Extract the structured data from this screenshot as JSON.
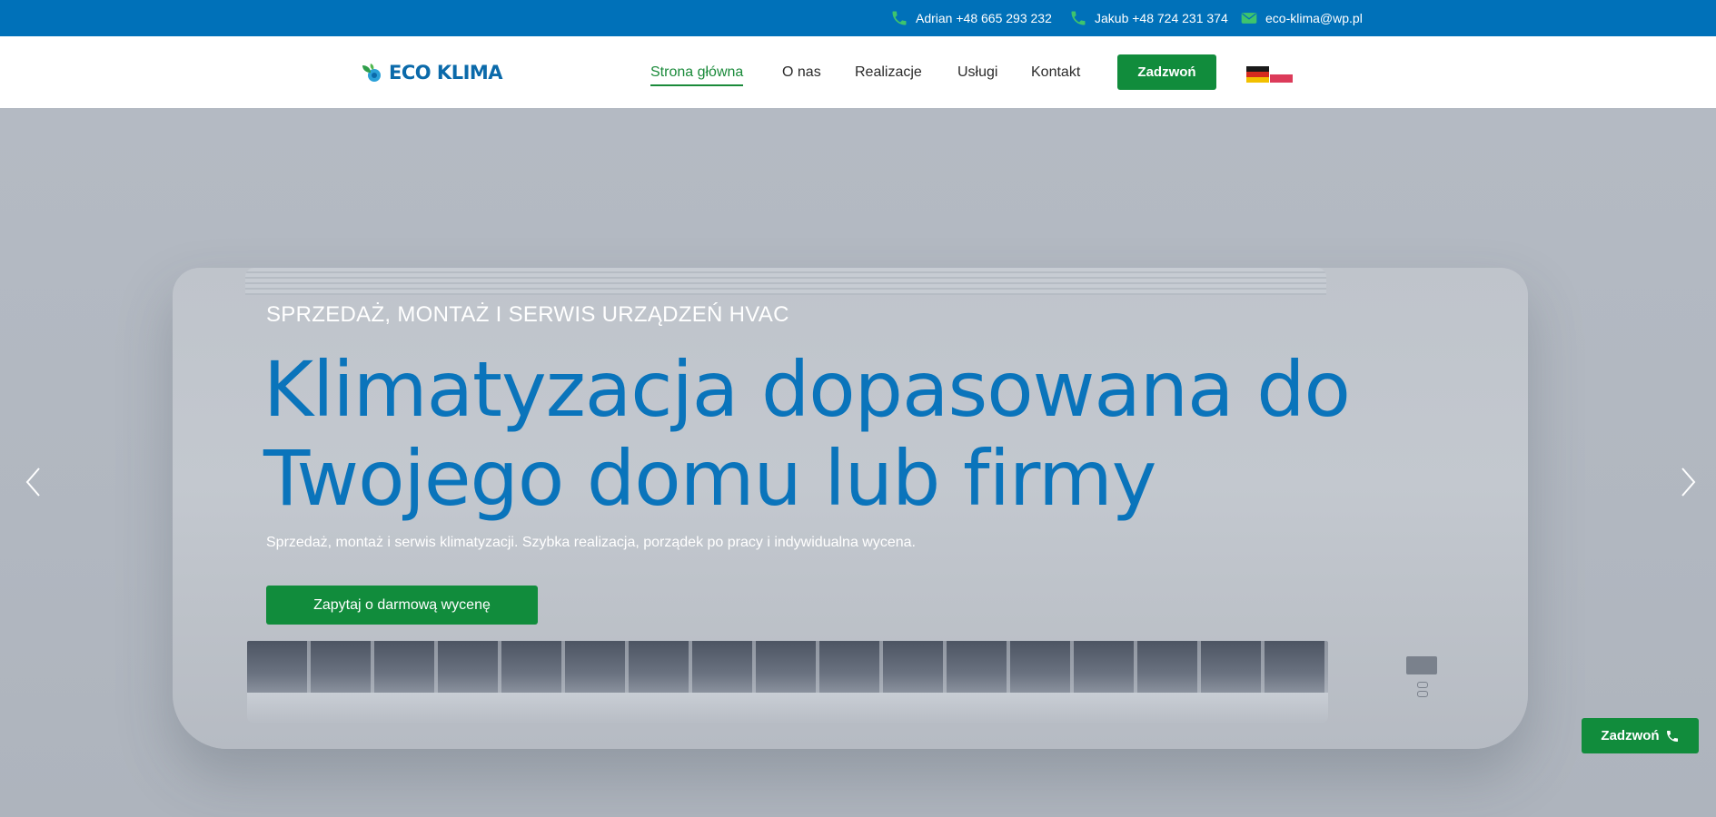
{
  "topbar": {
    "contacts": [
      {
        "icon": "phone-icon",
        "label": "Adrian +48 665 293 232"
      },
      {
        "icon": "phone-icon",
        "label": "Jakub +48 724 231 374"
      },
      {
        "icon": "envelope-icon",
        "label": "eco-klima@wp.pl"
      }
    ]
  },
  "header": {
    "logo_text": "ECO KLIMA",
    "nav": [
      {
        "label": "Strona główna",
        "active": true
      },
      {
        "label": "O nas"
      },
      {
        "label": "Realizacje"
      },
      {
        "label": "Usługi"
      },
      {
        "label": "Kontakt"
      }
    ],
    "call_label": "Zadzwoń",
    "flags": [
      "flag-de-icon",
      "flag-pl-icon"
    ]
  },
  "hero": {
    "subtitle": "SPRZEDAŻ, MONTAŻ I SERWIS URZĄDZEŃ HVAC",
    "headline_line1": "Klimatyzacja dopasowana do",
    "headline_line2": "Twojego domu lub firmy",
    "description": "Sprzedaż, montaż i serwis klimatyzacji. Szybka realizacja, porządek po pracy i indywidualna wycena.",
    "cta_label": "Zapytaj o darmową wycenę"
  },
  "floating": {
    "call_label": "Zadzwoń"
  },
  "colors": {
    "brand_blue": "#0071b9",
    "brand_green": "#118c3c",
    "headline_blue": "#0a74bb"
  }
}
